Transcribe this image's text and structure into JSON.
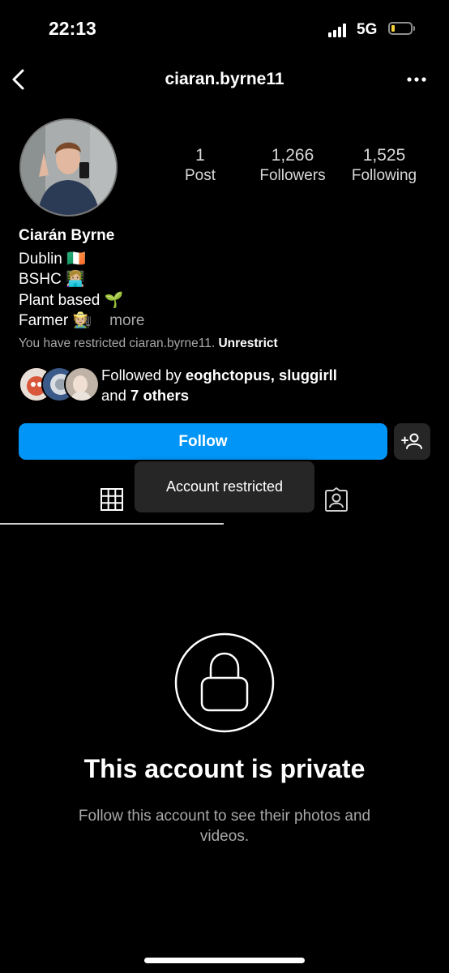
{
  "status_bar": {
    "time": "22:13",
    "network": "5G",
    "battery_level": 0.1,
    "battery_color": "#f7d23c"
  },
  "header": {
    "back_icon": "chevron-left-icon",
    "username": "ciaran.byrne11",
    "menu_icon": "more-horizontal-icon"
  },
  "stats": [
    {
      "value": "1",
      "label": "Post"
    },
    {
      "value": "1,266",
      "label": "Followers"
    },
    {
      "value": "1,525",
      "label": "Following"
    }
  ],
  "profile": {
    "name": "Ciarán Byrne",
    "bio_lines": [
      "Dublin 🇮🇪",
      "BSHC 👩🏼‍💻",
      "Plant based 🌱",
      "Farmer 🧑🏼‍🌾"
    ],
    "more_label": "more",
    "restricted_text": "You have restricted ciaran.byrne11.",
    "unrestrict_label": "Unrestrict"
  },
  "followed_by": {
    "prefix": "Followed by ",
    "names": "eoghctopus, sluggirll",
    "and": "and ",
    "others": "7 others"
  },
  "actions": {
    "follow_label": "Follow",
    "follow_color": "#0095f6",
    "add_person_icon": "add-person-icon"
  },
  "tabs": [
    {
      "icon": "grid-icon",
      "active": true
    },
    {
      "icon": "tagged-person-icon",
      "active": false
    }
  ],
  "tooltip": {
    "text": "Account restricted"
  },
  "private": {
    "icon": "lock-icon",
    "title": "This account is private",
    "subtitle": "Follow this account to see their photos and videos."
  }
}
